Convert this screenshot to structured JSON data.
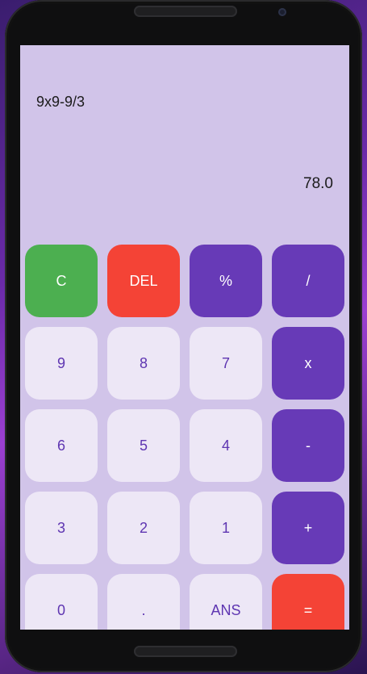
{
  "display": {
    "expression": "9x9-9/3",
    "result": "78.0"
  },
  "keys": [
    {
      "label": "C",
      "name": "clear-button",
      "type": "clear",
      "color": "#4caf50"
    },
    {
      "label": "DEL",
      "name": "delete-button",
      "type": "del",
      "color": "#f44336"
    },
    {
      "label": "%",
      "name": "percent-button",
      "type": "op",
      "color": "#673ab7"
    },
    {
      "label": "/",
      "name": "divide-button",
      "type": "op",
      "color": "#673ab7"
    },
    {
      "label": "9",
      "name": "digit-9-button",
      "type": "num"
    },
    {
      "label": "8",
      "name": "digit-8-button",
      "type": "num"
    },
    {
      "label": "7",
      "name": "digit-7-button",
      "type": "num"
    },
    {
      "label": "x",
      "name": "multiply-button",
      "type": "op"
    },
    {
      "label": "6",
      "name": "digit-6-button",
      "type": "num"
    },
    {
      "label": "5",
      "name": "digit-5-button",
      "type": "num"
    },
    {
      "label": "4",
      "name": "digit-4-button",
      "type": "num"
    },
    {
      "label": "-",
      "name": "subtract-button",
      "type": "op"
    },
    {
      "label": "3",
      "name": "digit-3-button",
      "type": "num"
    },
    {
      "label": "2",
      "name": "digit-2-button",
      "type": "num"
    },
    {
      "label": "1",
      "name": "digit-1-button",
      "type": "num"
    },
    {
      "label": "+",
      "name": "add-button",
      "type": "op"
    },
    {
      "label": "0",
      "name": "digit-0-button",
      "type": "num"
    },
    {
      "label": ".",
      "name": "decimal-button",
      "type": "num"
    },
    {
      "label": "ANS",
      "name": "answer-button",
      "type": "num"
    },
    {
      "label": "=",
      "name": "equals-button",
      "type": "eq",
      "color": "#f44336"
    }
  ],
  "colors": {
    "screen_bg": "#d1c4e9",
    "number_key_bg": "#ede7f6",
    "number_key_text": "#5e35b1",
    "operator_bg": "#673ab7",
    "clear_bg": "#4caf50",
    "danger_bg": "#f44336"
  }
}
